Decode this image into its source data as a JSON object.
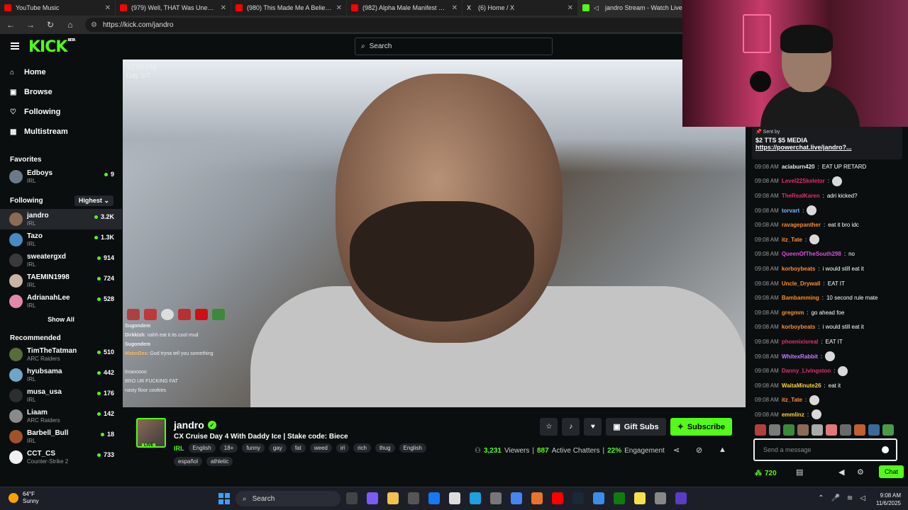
{
  "browser": {
    "tabs": [
      {
        "title": "YouTube Music",
        "color": "#ff0000"
      },
      {
        "title": "(979) Well, THAT Was Unexpected",
        "color": "#ff0000"
      },
      {
        "title": "(980) This Made Me A Believer in",
        "color": "#ff0000"
      },
      {
        "title": "(982) Alpha Male Manifest Guru F",
        "color": "#ff0000"
      },
      {
        "title": "(6) Home / X",
        "color": "#ffffff"
      },
      {
        "title": "jandro Stream - Watch Live",
        "color": "#53fc18"
      }
    ],
    "url": "https://kick.com/jandro"
  },
  "header": {
    "logo": "KICK",
    "logo_beta": "BETA",
    "search_placeholder": "Search"
  },
  "sidebar": {
    "nav": [
      {
        "label": "Home",
        "icon": "home-icon"
      },
      {
        "label": "Browse",
        "icon": "browse-icon"
      },
      {
        "label": "Following",
        "icon": "heart-icon"
      },
      {
        "label": "Multistream",
        "icon": "grid-icon"
      }
    ],
    "favorites_title": "Favorites",
    "favorites": [
      {
        "name": "Edboys",
        "sub": "IRL",
        "count": "9"
      }
    ],
    "following_title": "Following",
    "sort_label": "Highest",
    "following": [
      {
        "name": "jandro",
        "sub": "IRL",
        "count": "3.2K"
      },
      {
        "name": "Tazo",
        "sub": "IRL",
        "count": "1.3K"
      },
      {
        "name": "sweatergxd",
        "sub": "IRL",
        "count": "914"
      },
      {
        "name": "TAEMIN1998",
        "sub": "IRL",
        "count": "724"
      },
      {
        "name": "AdrianahLee",
        "sub": "IRL",
        "count": "528"
      }
    ],
    "show_all": "Show All",
    "recommended_title": "Recommended",
    "recommended": [
      {
        "name": "TimTheTatman",
        "sub": "ARC Raiders",
        "count": "510"
      },
      {
        "name": "hyubsama",
        "sub": "IRL",
        "count": "442"
      },
      {
        "name": "musa_usa",
        "sub": "IRL",
        "count": "176"
      },
      {
        "name": "Liaam",
        "sub": "ARC Raiders",
        "count": "142"
      },
      {
        "name": "Barbell_Bull",
        "sub": "IRL",
        "count": "18"
      },
      {
        "name": "CCT_CS",
        "sub": "Counter-Strike 2",
        "count": "733"
      }
    ]
  },
  "video": {
    "time": "12:08 PM",
    "day": "Day 5/7",
    "overlay_chat": [
      {
        "user": "Sugondem",
        "text": ""
      },
      {
        "user": "Dirkkish",
        "text": "nahh eat it its cool mud"
      },
      {
        "user": "Sugondem",
        "text": ""
      },
      {
        "user": "MaterDes",
        "text": "God tryna tell you something"
      },
      {
        "user": "",
        "text": ""
      },
      {
        "user": "",
        "text": "lmaooooo"
      },
      {
        "user": "",
        "text": "BRO UR FUCKING FAT"
      },
      {
        "user": "",
        "text": "nasty floor cookies"
      }
    ]
  },
  "stream": {
    "channel": "jandro",
    "live_label": "LIVE",
    "title": "CX Cruise Day 4 With Daddy Ice | Stake code: Biece",
    "category": "IRL",
    "tags": [
      "English",
      "18+",
      "funny",
      "gay",
      "fat",
      "weed",
      "irl",
      "rich",
      "thug",
      "English",
      "español",
      "athletic"
    ],
    "gift_label": "Gift Subs",
    "subscribe_label": "Subscribe",
    "viewers": "3,231",
    "viewers_label": "Viewers",
    "chatters": "887",
    "chatters_label": "Active Chatters",
    "engagement": "22%",
    "engagement_label": "Engagement"
  },
  "chat": {
    "pinned": {
      "sent_by": "Sent by",
      "line1": "$2 TTS $5 MEDIA",
      "line2": "https://powerchat.live/jandro?..."
    },
    "messages": [
      {
        "time": "09:08 AM",
        "user": "aciaburn420",
        "color": "#e8e8e8",
        "text": "EAT UP RETARD"
      },
      {
        "time": "09:08 AM",
        "user": "Level22Skeletor",
        "color": "#e0306a",
        "text": ""
      },
      {
        "time": "09:08 AM",
        "user": "TheRealKaren",
        "color": "#e0306a",
        "text": "adri kicked?"
      },
      {
        "time": "09:08 AM",
        "user": "torvart",
        "color": "#7fb2ff",
        "text": ""
      },
      {
        "time": "09:08 AM",
        "user": "ravagepanther",
        "color": "#ff8c2a",
        "text": "eat it bro idc"
      },
      {
        "time": "09:08 AM",
        "user": "itz_Tate",
        "color": "#ff8c2a",
        "text": ""
      },
      {
        "time": "09:08 AM",
        "user": "QueenOfTheSouth298",
        "color": "#d94fd9",
        "text": "no"
      },
      {
        "time": "09:08 AM",
        "user": "korboybeats",
        "color": "#ff8c2a",
        "text": "i would still eat it"
      },
      {
        "time": "09:08 AM",
        "user": "Uncle_Drywall",
        "color": "#ff8c2a",
        "text": "EAT IT"
      },
      {
        "time": "09:08 AM",
        "user": "Bambamming",
        "color": "#ff8c2a",
        "text": "10 second rule mate"
      },
      {
        "time": "09:08 AM",
        "user": "gregmm",
        "color": "#ff8c2a",
        "text": "go ahead foe"
      },
      {
        "time": "09:08 AM",
        "user": "korboybeats",
        "color": "#ff8c2a",
        "text": "i would still eat it"
      },
      {
        "time": "09:08 AM",
        "user": "phoenixisreal",
        "color": "#e0306a",
        "text": "EAT IT"
      },
      {
        "time": "09:08 AM",
        "user": "WhitexRabbit",
        "color": "#c77dff",
        "text": ""
      },
      {
        "time": "09:08 AM",
        "user": "Danny_Livingston",
        "color": "#e0306a",
        "text": ""
      },
      {
        "time": "09:08 AM",
        "user": "WaitaMinute26",
        "color": "#ffd23f",
        "text": "eat it"
      },
      {
        "time": "09:08 AM",
        "user": "itz_Tate",
        "color": "#ff8c2a",
        "text": ""
      },
      {
        "time": "09:08 AM",
        "user": "emmlinz",
        "color": "#ffd23f",
        "text": ""
      }
    ],
    "input_placeholder": "Send a message",
    "points": "720",
    "chat_button": "Chat"
  },
  "taskbar": {
    "temp": "64°F",
    "weather": "Sunny",
    "search_label": "Search",
    "time": "9:08 AM",
    "date": "11/6/2025"
  },
  "colors": {
    "accent": "#53fc18",
    "background": "#0b0e0f",
    "panel": "#24272c"
  }
}
